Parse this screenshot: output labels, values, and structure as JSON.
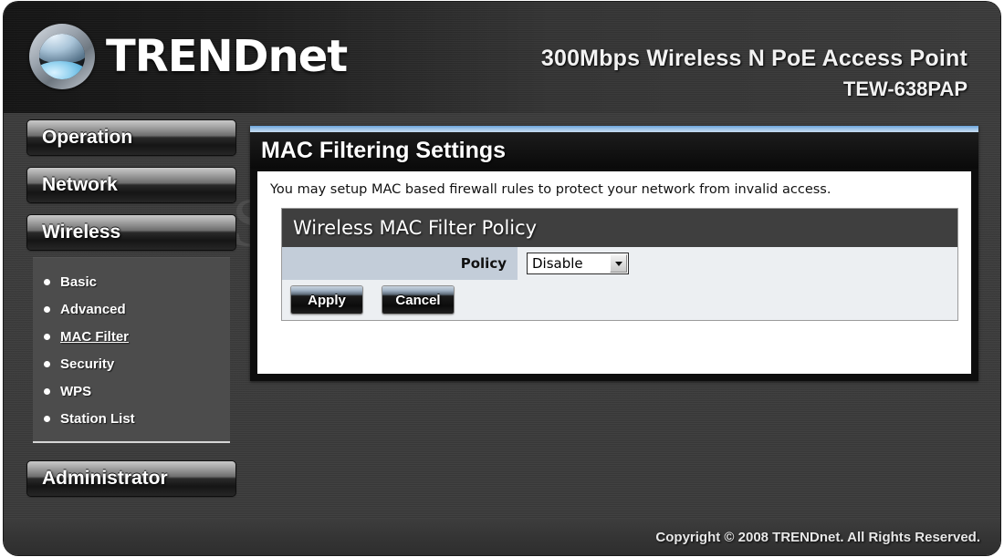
{
  "header": {
    "brand": "TRENDnet",
    "brand_upper": "TRENDn",
    "brand_lower": "et",
    "logo_icon": "trendnet-globe-logo-icon",
    "product_name": "300Mbps Wireless N PoE Access Point",
    "model_number": "TEW-638PAP"
  },
  "sidebar": {
    "buttons": [
      {
        "label": "Operation"
      },
      {
        "label": "Network"
      },
      {
        "label": "Wireless"
      },
      {
        "label": "Administrator"
      }
    ],
    "submenu": [
      {
        "label": "Basic",
        "active": false
      },
      {
        "label": "Advanced",
        "active": false
      },
      {
        "label": "MAC Filter",
        "active": true
      },
      {
        "label": "Security",
        "active": false
      },
      {
        "label": "WPS",
        "active": false
      },
      {
        "label": "Station List",
        "active": false
      }
    ]
  },
  "content": {
    "title": "MAC Filtering Settings",
    "intro": "You may setup MAC based firewall rules to protect your network from invalid access.",
    "policy_box": {
      "heading": "Wireless MAC Filter Policy",
      "policy_label": "Policy",
      "policy_value": "Disable",
      "policy_options": [
        "Disable"
      ],
      "dropdown_icon": "chevron-down-icon"
    },
    "buttons": {
      "apply": "Apply",
      "cancel": "Cancel"
    }
  },
  "footer": {
    "copyright": "Copyright © 2008 TRENDnet. All Rights Reserved."
  },
  "watermark": {
    "text": "SetupRouter.com"
  },
  "colors": {
    "page_background": "#3b3b3b",
    "header_background": "#1b1b1b",
    "accent_blue": "#9dc4e8",
    "panel_label_blue": "#c3cdd9",
    "submenu_background": "#4c4c4c",
    "content_white": "#ffffff"
  }
}
